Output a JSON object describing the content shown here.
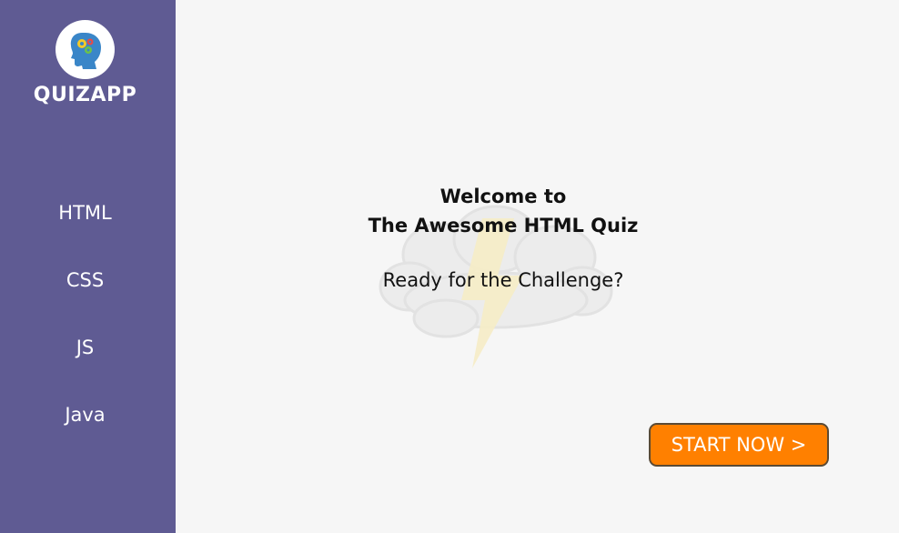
{
  "brand": {
    "name": "QUIZAPP",
    "logo_icon": "brain-gears-icon"
  },
  "sidebar": {
    "items": [
      {
        "label": "HTML"
      },
      {
        "label": "CSS"
      },
      {
        "label": "JS"
      },
      {
        "label": "Java"
      }
    ]
  },
  "main": {
    "welcome_line1": "Welcome to",
    "welcome_line2": "The Awesome HTML Quiz",
    "tagline": "Ready for the Challenge?",
    "background_icon": "storm-cloud-icon",
    "start_button": "START NOW >"
  },
  "colors": {
    "sidebar": "#5f5b93",
    "background": "#f6f6f6",
    "accent": "#ff8000"
  }
}
